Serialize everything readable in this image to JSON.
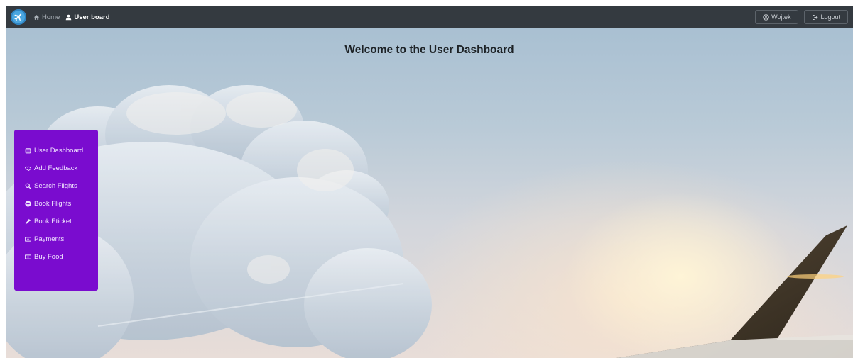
{
  "navbar": {
    "brand_icon": "airplane-icon",
    "links": [
      {
        "label": "Home",
        "icon": "home-icon",
        "active": false
      },
      {
        "label": "User board",
        "icon": "user-icon",
        "active": true
      }
    ],
    "user_button": {
      "label": "Wojtek",
      "icon": "user-circle-icon"
    },
    "logout_button": {
      "label": "Logout",
      "icon": "logout-icon"
    }
  },
  "main": {
    "title": "Welcome to the User Dashboard"
  },
  "sidebar": {
    "items": [
      {
        "label": "User Dashboard",
        "icon": "calendar-icon"
      },
      {
        "label": "Add Feedback",
        "icon": "handshake-icon"
      },
      {
        "label": "Search Flights",
        "icon": "search-icon"
      },
      {
        "label": "Book Flights",
        "icon": "plus-circle-icon"
      },
      {
        "label": "Book Eticket",
        "icon": "plug-icon"
      },
      {
        "label": "Payments",
        "icon": "money-bill-icon"
      },
      {
        "label": "Buy Food",
        "icon": "money-bill-icon"
      }
    ]
  },
  "colors": {
    "navbar_bg": "#343a40",
    "sidebar_bg": "#7a0ccf",
    "brand": "#4aa6e0"
  }
}
